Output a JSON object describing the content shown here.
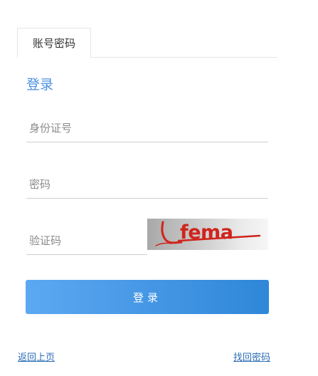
{
  "tabs": [
    {
      "label": "账号密码",
      "active": true
    }
  ],
  "login": {
    "title": "登录",
    "id_placeholder": "身份证号",
    "password_placeholder": "密码",
    "captcha_placeholder": "验证码",
    "captcha_code": "fema",
    "submit_label": "登录"
  },
  "links": {
    "back": "返回上页",
    "find_password": "找回密码"
  },
  "colors": {
    "accent": "#4a90e2",
    "button_start": "#5ca8f2",
    "button_end": "#2f87d8",
    "captcha_text": "#d0241c",
    "link": "#2b6cb5"
  }
}
